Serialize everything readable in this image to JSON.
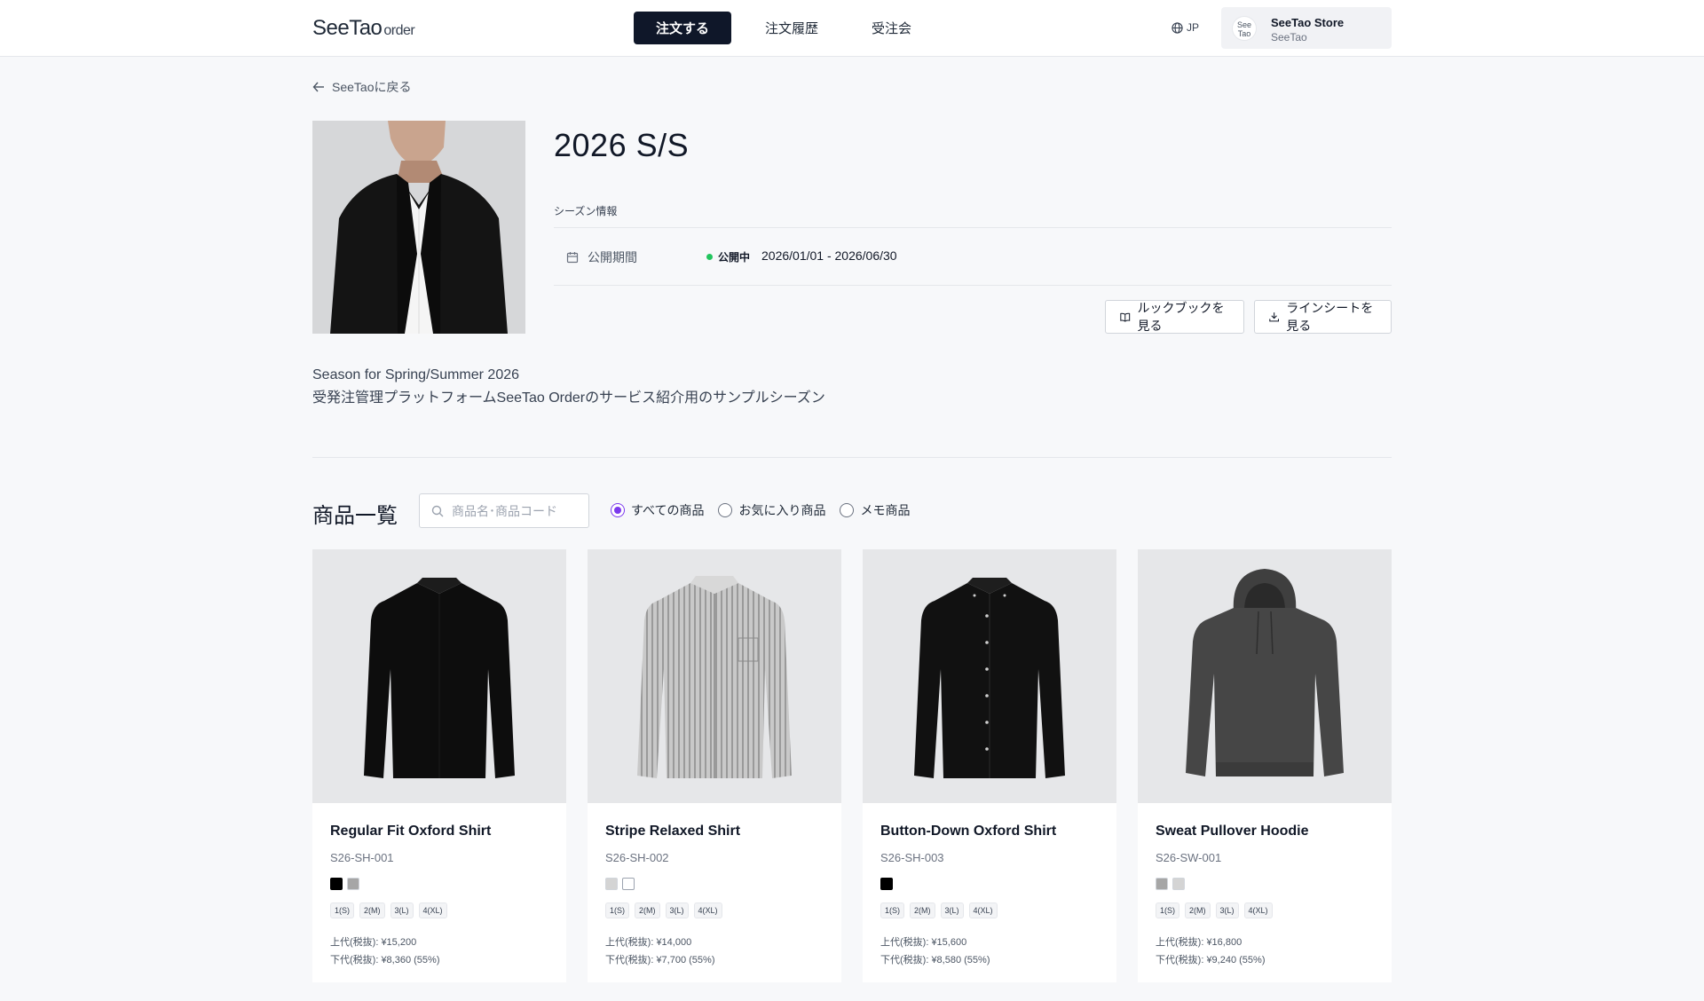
{
  "header": {
    "logo": "SeeTao",
    "logo_suffix": "order",
    "nav": [
      "注文する",
      "注文履歴",
      "受注会"
    ],
    "lang": "JP",
    "store_avatar_line1": "See",
    "store_avatar_line2": "Tao",
    "store_name": "SeeTao Store",
    "store_sub": "SeeTao"
  },
  "back_label": "SeeTaoに戻る",
  "season": {
    "title": "2026 S/S",
    "info_label": "シーズン情報",
    "period_label": "公開期間",
    "status": "公開中",
    "period": "2026/01/01 - 2026/06/30",
    "lookbook_label": "ルックブックを見る",
    "linesheet_label": "ラインシートを見る",
    "desc_line1": "Season for Spring/Summer 2026",
    "desc_line2": "受発注管理プラットフォームSeeTao Orderのサービス紹介用のサンプルシーズン"
  },
  "products": {
    "title": "商品一覧",
    "search_placeholder": "商品名･商品コード",
    "filters": [
      "すべての商品",
      "お気に入り商品",
      "メモ商品"
    ],
    "items": [
      {
        "name": "Regular Fit Oxford Shirt",
        "code": "S26-SH-001",
        "colors": [
          "#000000",
          "#a6a6a6"
        ],
        "sizes": [
          "1(S)",
          "2(M)",
          "3(L)",
          "4(XL)"
        ],
        "retail": "上代(税抜): ¥15,200",
        "wholesale": "下代(税抜): ¥8,360 (55%)"
      },
      {
        "name": "Stripe Relaxed Shirt",
        "code": "S26-SH-002",
        "colors": [
          "#d4d4d4",
          "#ffffff"
        ],
        "sizes": [
          "1(S)",
          "2(M)",
          "3(L)",
          "4(XL)"
        ],
        "retail": "上代(税抜): ¥14,000",
        "wholesale": "下代(税抜): ¥7,700 (55%)"
      },
      {
        "name": "Button-Down Oxford Shirt",
        "code": "S26-SH-003",
        "colors": [
          "#000000"
        ],
        "sizes": [
          "1(S)",
          "2(M)",
          "3(L)",
          "4(XL)"
        ],
        "retail": "上代(税抜): ¥15,600",
        "wholesale": "下代(税抜): ¥8,580 (55%)"
      },
      {
        "name": "Sweat Pullover Hoodie",
        "code": "S26-SW-001",
        "colors": [
          "#a6a6a6",
          "#d4d4d4"
        ],
        "sizes": [
          "1(S)",
          "2(M)",
          "3(L)",
          "4(XL)"
        ],
        "retail": "上代(税抜): ¥16,800",
        "wholesale": "下代(税抜): ¥9,240 (55%)"
      }
    ]
  }
}
